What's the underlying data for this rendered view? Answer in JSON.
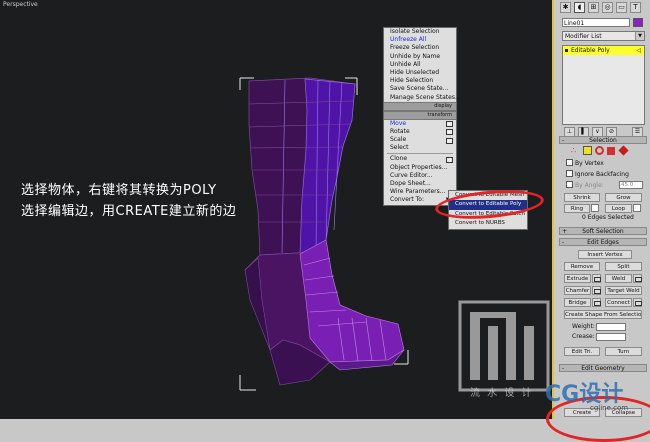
{
  "viewport": {
    "label": "Perspective",
    "overlay_lines": [
      "选择物体，右键将其转换为POLY",
      "选择编辑边，用CREATE建立新的边"
    ],
    "model_color": "#5a1a7a"
  },
  "quad_menu": {
    "display_items": [
      "Isolate Selection",
      "Unfreeze All",
      "Freeze Selection",
      "Unhide by Name",
      "Unhide All",
      "Hide Unselected",
      "Hide Selection",
      "Save Scene State...",
      "Manage Scene States..."
    ],
    "display_header": "display",
    "transform_header": "transform",
    "transform_items": [
      "Move",
      "Rotate",
      "Scale",
      "Select",
      "Clone",
      "Object Properties...",
      "Curve Editor...",
      "Dope Sheet...",
      "Wire Parameters...",
      "Convert To:"
    ],
    "highlight_items": [
      "Unfreeze All",
      "Move"
    ]
  },
  "convert_submenu": {
    "items": [
      "Convert to Editable Mesh",
      "Convert to Editable Poly",
      "Convert to Editable Patch",
      "Convert to NURBS"
    ],
    "selected": "Convert to Editable Poly"
  },
  "panel": {
    "object_name": "Line01",
    "object_color": "#8c20c2",
    "modifier_list": "Modifier List",
    "stack_selected": "Editable Poly",
    "selection": {
      "title": "Selection",
      "by_vertex": "By Vertex",
      "ignore_backfacing": "Ignore Backfacing",
      "by_angle": "By Angle:",
      "angle_value": "45.0",
      "shrink": "Shrink",
      "grow": "Grow",
      "ring": "Ring",
      "loop": "Loop",
      "status": "0 Edges Selected"
    },
    "soft_selection": "Soft Selection",
    "edit_edges": {
      "title": "Edit Edges",
      "insert_vertex": "Insert Vertex",
      "remove": "Remove",
      "split": "Split",
      "extrude": "Extrude",
      "weld": "Weld",
      "chamfer": "Chamfer",
      "target_weld": "Target Weld",
      "bridge": "Bridge",
      "connect": "Connect",
      "create_shape": "Create Shape From Selection",
      "weight": "Weight:",
      "crease": "Crease:",
      "edit_tri": "Edit Tri.",
      "turn": "Turn"
    },
    "edit_geometry": "Edit Geometry",
    "create": "Create",
    "collapse": "Collapse"
  },
  "watermark": {
    "text": "流 水 设 计",
    "brand": "CG设计",
    "url": "cgline.com"
  }
}
